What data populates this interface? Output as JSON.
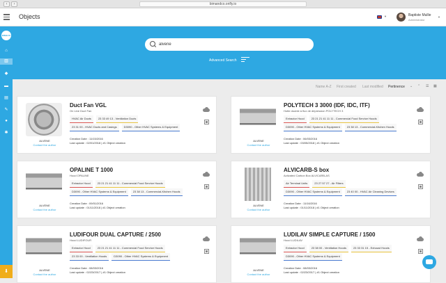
{
  "browser": {
    "url": "bimandco.onfly.io",
    "back_glyph": "‹",
    "forward_glyph": "›"
  },
  "header": {
    "title": "Objects",
    "user_name": "Baptiste Mullie",
    "user_role": "Administrator"
  },
  "sidebar": {
    "logo_text": "BIM&CO",
    "icons": [
      "home-icon",
      "buildings-icon",
      "cube-icon",
      "folder-icon",
      "document-icon",
      "edit-icon",
      "chat-icon",
      "gear-icon"
    ],
    "download_icon": "download-icon"
  },
  "search": {
    "value": "alvene",
    "advanced_label": "Advanced Search"
  },
  "sort": {
    "options": [
      "Name A-Z",
      "First created",
      "Last modified",
      "Pertinence"
    ],
    "active": "Pertinence"
  },
  "colors": {
    "accent": "#2ea8e2",
    "download": "#f0ad1a"
  },
  "objects": [
    {
      "title": "Duct Fan VGL",
      "subtitle": "On Line Duct Fan",
      "vendor": "ALVENE",
      "contact": "Contact the author",
      "tags": [
        [
          {
            "text": "HVAC Air Ducts",
            "color": "red"
          },
          {
            "text": "23 33 49 13 - Ventilation Ducts",
            "color": "yellow"
          }
        ],
        [
          {
            "text": "23 31 00 - HVAC Ducts and Casings",
            "color": "blue"
          },
          {
            "text": "D3090 - Other HVAC Systems & Equipment",
            "color": "blue"
          }
        ]
      ],
      "created": "Creation Date : 11/15/2016",
      "updated": "Last update : 02/01/2018 | #1 Object creation"
    },
    {
      "title": "POLYTECH 3 3000 (IDF, IDC, ITF)",
      "subtitle": "Hotte double à flux de dépression POLYTECH 3",
      "vendor": "ALVENE",
      "contact": "Contact the author",
      "tags": [
        [
          {
            "text": "Extractor Hood",
            "color": "red"
          },
          {
            "text": "23 21 21 41 11 11 - Commercial Food Service Hoods",
            "color": "yellow"
          }
        ],
        [
          {
            "text": "D3090 - Other HVAC Systems & Equipment",
            "color": "blue"
          },
          {
            "text": "23 38 13 - Commercial-Kitchen Hoods",
            "color": "blue"
          }
        ]
      ],
      "created": "Creation Date : 06/03/2016",
      "updated": "Last update : 03/05/2018 | #1 Object creation"
    },
    {
      "title": "OPALINE T 1000",
      "subtitle": "Hood OPALINE",
      "vendor": "ALVENE",
      "contact": "Contact the author",
      "tags": [
        [
          {
            "text": "Extractor Hood",
            "color": "red"
          },
          {
            "text": "23 21 21 41 11 11 - Commercial Food Service Hoods",
            "color": "yellow"
          }
        ],
        [
          {
            "text": "D3090 - Other HVAC Systems & Equipment",
            "color": "blue"
          },
          {
            "text": "23 38 13 - Commercial-Kitchen Hoods",
            "color": "blue"
          }
        ]
      ],
      "created": "Creation Date : 09/01/2016",
      "updated": "Last update : 01/11/2018 | #1 Object creation"
    },
    {
      "title": "ALVICARB-S box",
      "subtitle": "Activated Carbon Box ALVICARB-AS",
      "vendor": "ALVENE",
      "contact": "Contact the author",
      "tags": [
        [
          {
            "text": "Air Terminal Units",
            "color": "red"
          },
          {
            "text": "23 27 57 27 - Air Filters",
            "color": "yellow"
          }
        ],
        [
          {
            "text": "D3090 - Other HVAC Systems & Equipment",
            "color": "blue"
          },
          {
            "text": "23 40 00 - HVAC Air Cleaning Devices",
            "color": "blue"
          }
        ]
      ],
      "created": "Creation Date : 11/16/2016",
      "updated": "Last update : 01/11/2018 | #1 Object creation"
    },
    {
      "title": "LUDIFOUR DUAL CAPTURE / 2500",
      "subtitle": "Hood LUDIFOUR",
      "vendor": "ALVENE",
      "contact": "Contact the author",
      "tags": [
        [
          {
            "text": "Extractor Hood",
            "color": "red"
          },
          {
            "text": "23 21 21 41 11 11 - Commercial Food Service Hoods",
            "color": "yellow"
          }
        ],
        [
          {
            "text": "23 33 00 - Ventilation Hoods",
            "color": "blue"
          },
          {
            "text": "D3090 - Other HVAC Systems & Equipment",
            "color": "blue"
          }
        ]
      ],
      "created": "Creation Date : 08/03/2016",
      "updated": "Last update : 02/23/2017 | #1 Object creation"
    },
    {
      "title": "LUDILAV SIMPLE CAPTURE / 1500",
      "subtitle": "Hood LUDILAV",
      "vendor": "ALVENE",
      "contact": "Contact the author",
      "tags": [
        [
          {
            "text": "Extractor Hood",
            "color": "red"
          },
          {
            "text": "23 38 00 - Ventilation Hoods",
            "color": "yellow"
          },
          {
            "text": "23 33 31 15 - Exhaust Hoods",
            "color": "yellow"
          }
        ],
        [
          {
            "text": "D3090 - Other HVAC Systems & Equipment",
            "color": "blue"
          }
        ]
      ],
      "created": "Creation Date : 08/03/2016",
      "updated": "Last update : 02/23/2017 | #1 Object creation"
    }
  ]
}
